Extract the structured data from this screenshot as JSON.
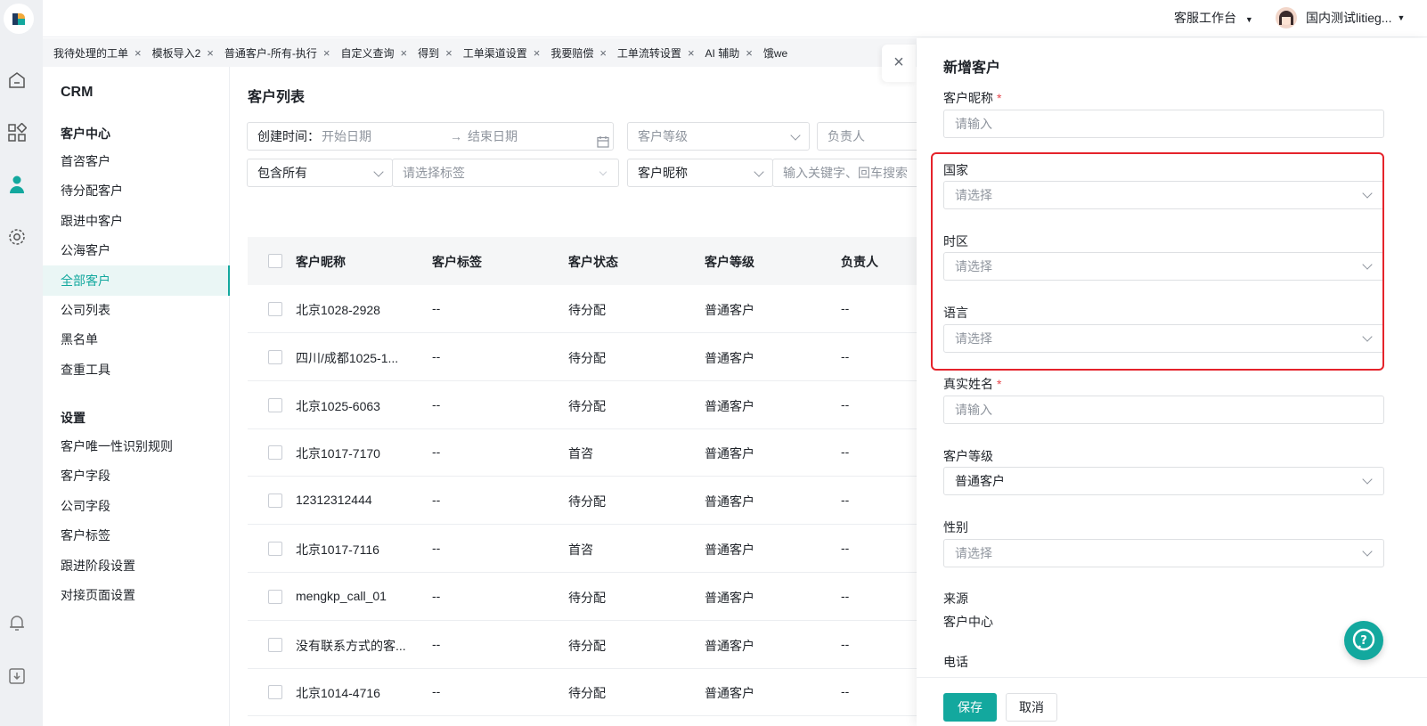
{
  "header": {
    "workbench": "客服工作台",
    "user_name": "国内测试litieg..."
  },
  "tabs": [
    {
      "label": "我待处理的工单"
    },
    {
      "label": "模板导入2"
    },
    {
      "label": "普通客户-所有-执行"
    },
    {
      "label": "自定义查询"
    },
    {
      "label": "得到"
    },
    {
      "label": "工单渠道设置"
    },
    {
      "label": "我要赔偿"
    },
    {
      "label": "工单流转设置"
    },
    {
      "label": "AI 辅助"
    },
    {
      "label": "饿we"
    }
  ],
  "tab_close": "×",
  "sidebar": {
    "title": "CRM",
    "section1": "客户中心",
    "items1": [
      "首咨客户",
      "待分配客户",
      "跟进中客户",
      "公海客户",
      "全部客户",
      "公司列表",
      "黑名单",
      "查重工具"
    ],
    "section2": "设置",
    "items2": [
      "客户唯一性识别规则",
      "客户字段",
      "公司字段",
      "客户标签",
      "跟进阶段设置",
      "对接页面设置"
    ],
    "active": "全部客户"
  },
  "main": {
    "title": "客户列表",
    "filters": {
      "created_label": "创建时间：",
      "start_date": "开始日期",
      "arrow": "→",
      "end_date": "结束日期",
      "level": "客户等级",
      "owner": "负责人",
      "contains": "包含所有",
      "tags": "请选择标签",
      "nickname": "客户昵称",
      "keyword": "输入关键字、回车搜索"
    },
    "columns": [
      "客户昵称",
      "客户标签",
      "客户状态",
      "客户等级",
      "负责人"
    ],
    "rows": [
      [
        "北京1028-2928",
        "--",
        "待分配",
        "普通客户",
        "--"
      ],
      [
        "四川/成都1025-1...",
        "--",
        "待分配",
        "普通客户",
        "--"
      ],
      [
        "北京1025-6063",
        "--",
        "待分配",
        "普通客户",
        "--"
      ],
      [
        "北京1017-7170",
        "--",
        "首咨",
        "普通客户",
        "--"
      ],
      [
        "12312312444",
        "--",
        "待分配",
        "普通客户",
        "--"
      ],
      [
        "北京1017-7116",
        "--",
        "首咨",
        "普通客户",
        "--"
      ],
      [
        "mengkp_call_01",
        "--",
        "待分配",
        "普通客户",
        "--"
      ],
      [
        "没有联系方式的客...",
        "--",
        "待分配",
        "普通客户",
        "--"
      ],
      [
        "北京1014-4716",
        "--",
        "待分配",
        "普通客户",
        "--"
      ]
    ]
  },
  "drawer": {
    "title": "新增客户",
    "close": "×",
    "nickname_label": "客户昵称",
    "required_mark": "*",
    "input_placeholder": "请输入",
    "select_placeholder": "请选择",
    "country_label": "国家",
    "timezone_label": "时区",
    "language_label": "语言",
    "realname_label": "真实姓名",
    "level_label": "客户等级",
    "level_value": "普通客户",
    "gender_label": "性别",
    "source_label": "来源",
    "source_value": "客户中心",
    "phone_label": "电话",
    "save": "保存",
    "cancel": "取消"
  },
  "colors": {
    "accent": "#13a89e",
    "highlight": "#e5232b",
    "required": "#e5484d"
  }
}
